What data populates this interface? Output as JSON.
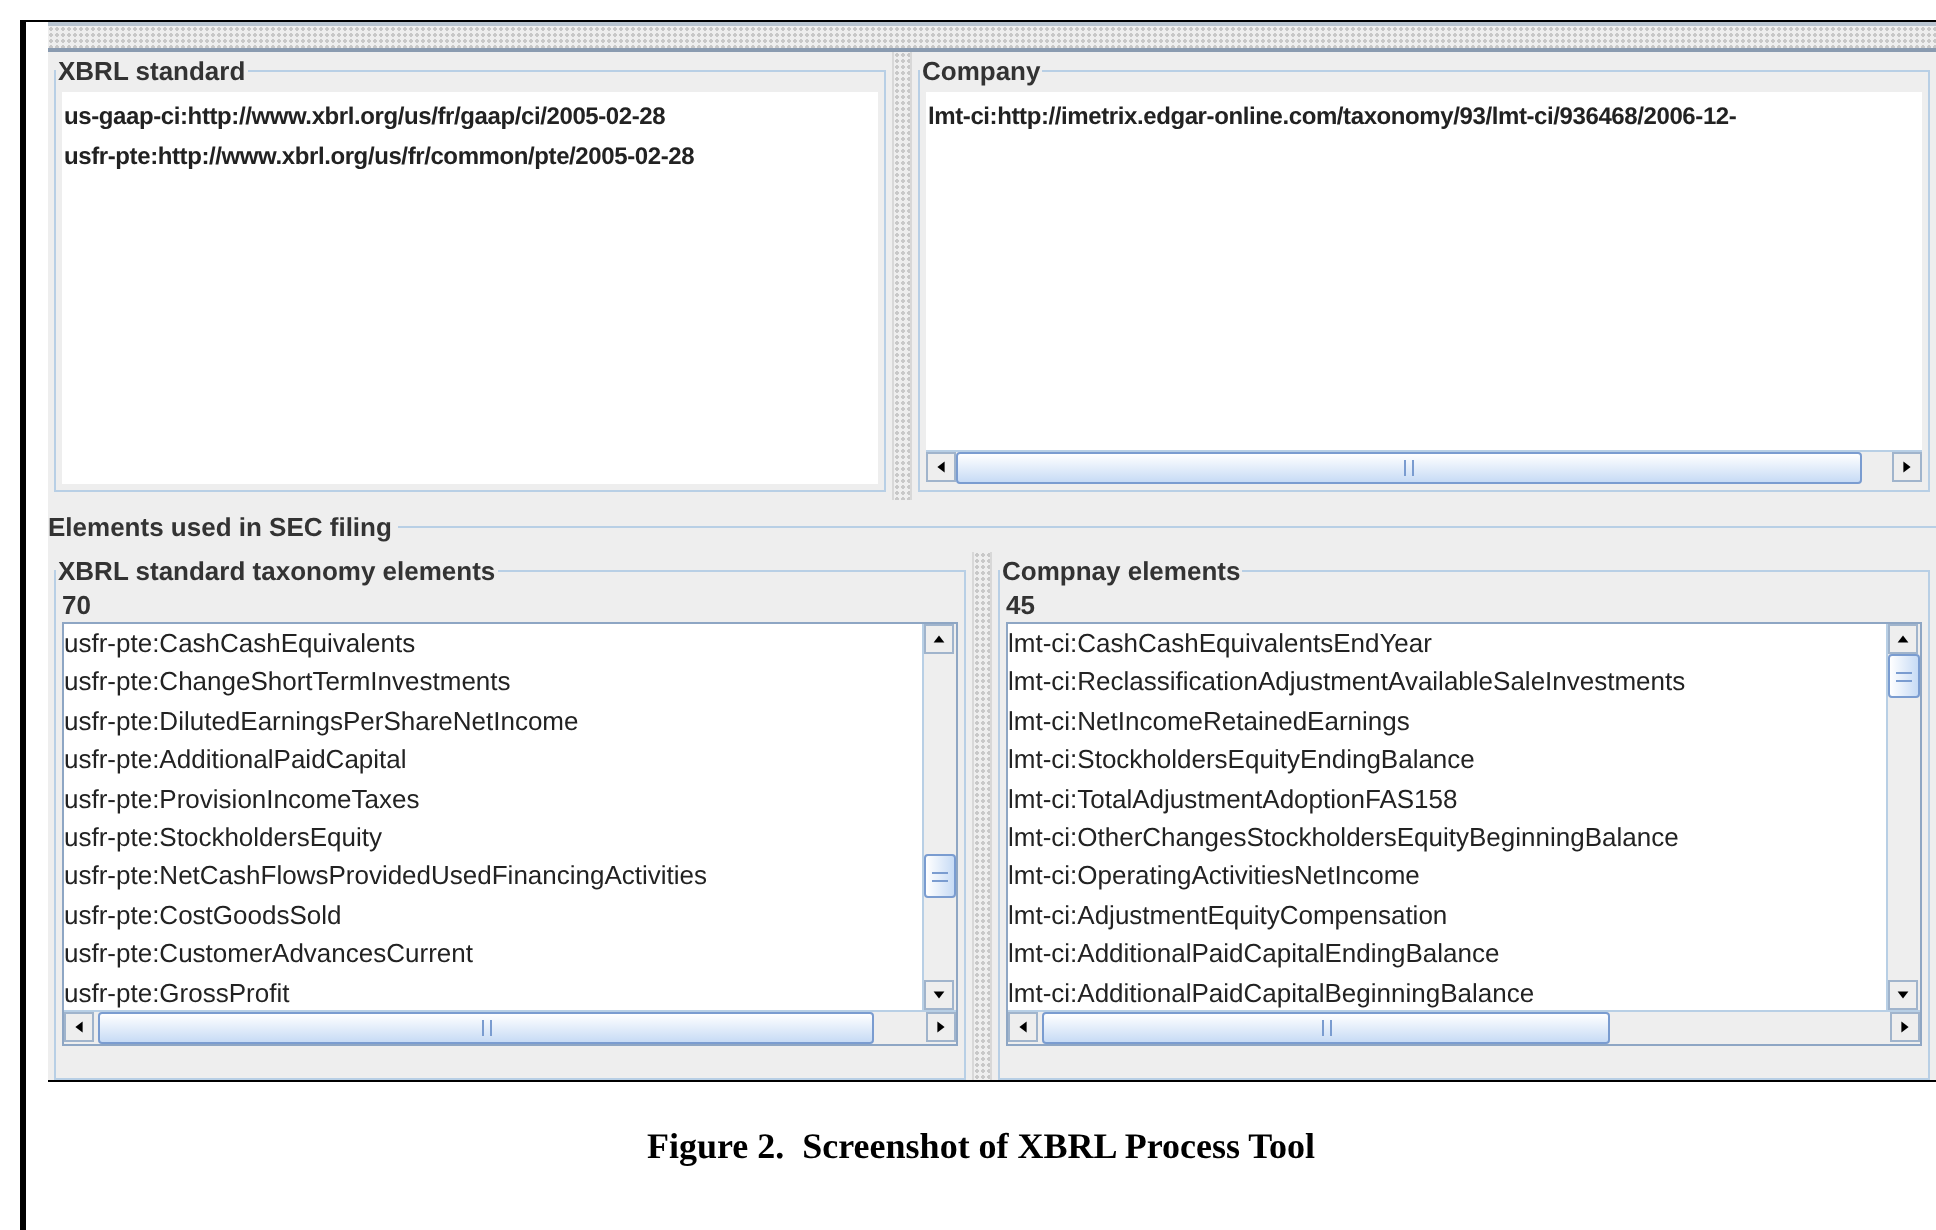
{
  "top_panels": [
    {
      "title": "XBRL standard",
      "kind": "plain",
      "lines": [
        "us-gaap-ci:http://www.xbrl.org/us/fr/gaap/ci/2005-02-28",
        "usfr-pte:http://www.xbrl.org/us/fr/common/pte/2005-02-28"
      ]
    },
    {
      "title": "Company",
      "kind": "scrolling",
      "lines": [
        "lmt-ci:http://imetrix.edgar-online.com/taxonomy/93/lmt-ci/936468/2006-12-"
      ]
    }
  ],
  "elements_section": {
    "title": "Elements used in SEC filing",
    "panels": [
      {
        "title": "XBRL standard taxonomy elements",
        "count": "70",
        "items": [
          "usfr-pte:CashCashEquivalents",
          "usfr-pte:ChangeShortTermInvestments",
          "usfr-pte:DilutedEarningsPerShareNetIncome",
          "usfr-pte:AdditionalPaidCapital",
          "usfr-pte:ProvisionIncomeTaxes",
          "usfr-pte:StockholdersEquity",
          "usfr-pte:NetCashFlowsProvidedUsedFinancingActivities",
          "usfr-pte:CostGoodsSold",
          "usfr-pte:CustomerAdvancesCurrent",
          "usfr-pte:GrossProfit"
        ]
      },
      {
        "title": "Compnay elements",
        "count": "45",
        "items": [
          "lmt-ci:CashCashEquivalentsEndYear",
          "lmt-ci:ReclassificationAdjustmentAvailableSaleInvestments",
          "lmt-ci:NetIncomeRetainedEarnings",
          "lmt-ci:StockholdersEquityEndingBalance",
          "lmt-ci:TotalAdjustmentAdoptionFAS158",
          "lmt-ci:OtherChangesStockholdersEquityBeginningBalance",
          "lmt-ci:OperatingActivitiesNetIncome",
          "lmt-ci:AdjustmentEquityCompensation",
          "lmt-ci:AdditionalPaidCapitalEndingBalance",
          "lmt-ci:AdditionalPaidCapitalBeginningBalance"
        ]
      }
    ]
  },
  "caption": "Figure 2.  Screenshot of XBRL Process Tool"
}
